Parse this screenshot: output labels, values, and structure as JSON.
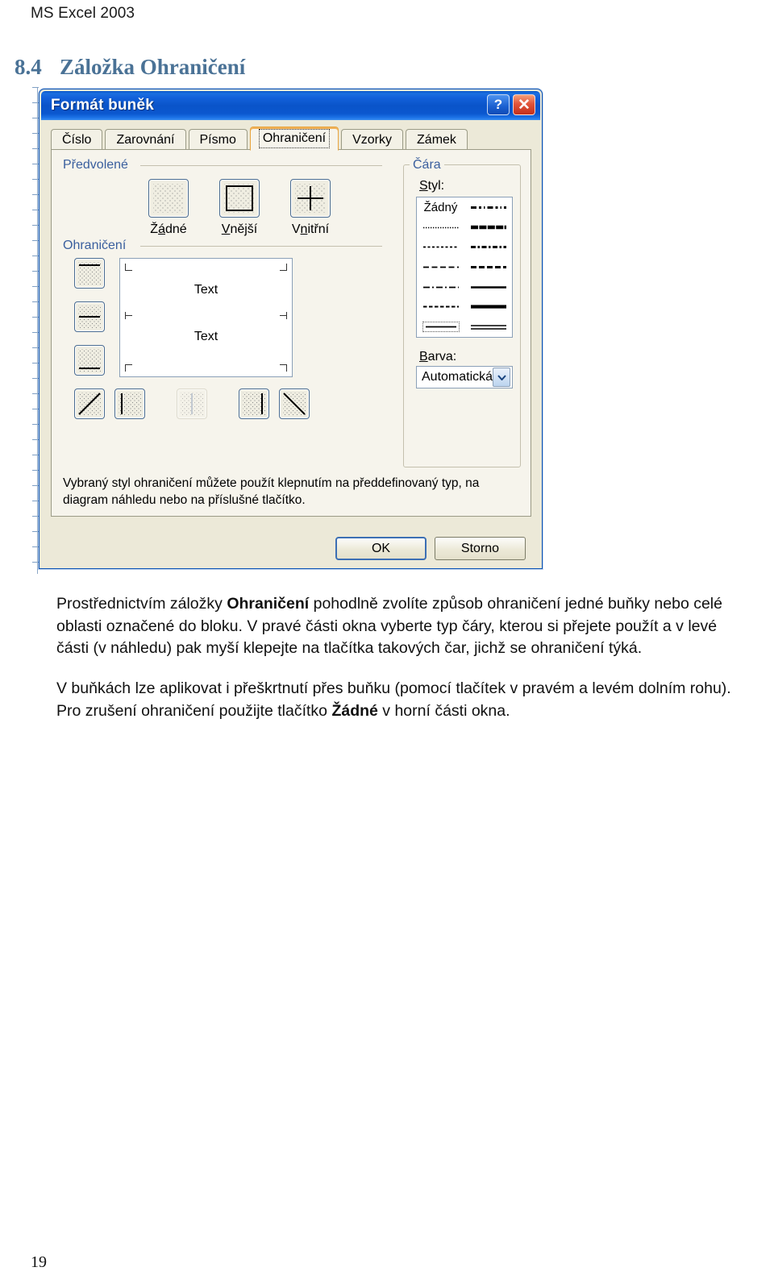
{
  "document": {
    "running_header": "MS Excel 2003",
    "section_number": "8.4",
    "section_title": "Záložka Ohraničení",
    "page_number": "19"
  },
  "dialog": {
    "title": "Formát buněk",
    "titlebar_buttons": {
      "help": "?",
      "close": "✕"
    },
    "tabs": [
      {
        "label": "Číslo",
        "active": false
      },
      {
        "label": "Zarovnání",
        "active": false
      },
      {
        "label": "Písmo",
        "active": false
      },
      {
        "label": "Ohraničení",
        "active": true
      },
      {
        "label": "Vzorky",
        "active": false
      },
      {
        "label": "Zámek",
        "active": false
      }
    ],
    "presets": {
      "group_label": "Předvolené",
      "buttons": [
        {
          "caption": "Žádné",
          "icon": "border-none-icon"
        },
        {
          "caption": "Vnější",
          "icon": "border-outline-icon"
        },
        {
          "caption": "Vnitřní",
          "icon": "border-inside-icon"
        }
      ]
    },
    "borders": {
      "group_label": "Ohraničení",
      "left_buttons": [
        {
          "icon": "border-top-icon"
        },
        {
          "icon": "border-horizontal-middle-icon"
        },
        {
          "icon": "border-bottom-icon"
        }
      ],
      "bottom_buttons": [
        {
          "icon": "border-diagonal-up-icon",
          "disabled": false
        },
        {
          "icon": "border-left-icon",
          "disabled": false
        },
        {
          "icon": "border-vertical-middle-icon",
          "disabled": true
        },
        {
          "icon": "border-right-icon",
          "disabled": false
        },
        {
          "icon": "border-diagonal-down-icon",
          "disabled": false
        }
      ],
      "preview": {
        "text_top": "Text",
        "text_bottom": "Text"
      }
    },
    "line": {
      "group_label": "Čára",
      "style_label": "Styl:",
      "style_none_label": "Žádný",
      "styles": [
        {
          "column": "left",
          "row": 1,
          "name": "none"
        },
        {
          "column": "left",
          "row": 2,
          "name": "fine-dotted"
        },
        {
          "column": "left",
          "row": 3,
          "name": "dotted"
        },
        {
          "column": "left",
          "row": 4,
          "name": "dashed-wide"
        },
        {
          "column": "left",
          "row": 5,
          "name": "dash-dot"
        },
        {
          "column": "left",
          "row": 6,
          "name": "dashed"
        },
        {
          "column": "left",
          "row": 7,
          "name": "thin-selected"
        },
        {
          "column": "right",
          "row": 1,
          "name": "dash-dot-dot"
        },
        {
          "column": "right",
          "row": 2,
          "name": "slanted-dash"
        },
        {
          "column": "right",
          "row": 3,
          "name": "medium-dash-dot"
        },
        {
          "column": "right",
          "row": 4,
          "name": "medium-dashed"
        },
        {
          "column": "right",
          "row": 5,
          "name": "thin-solid"
        },
        {
          "column": "right",
          "row": 6,
          "name": "thick-solid"
        },
        {
          "column": "right",
          "row": 7,
          "name": "double"
        }
      ],
      "color_label": "Barva:",
      "color_value": "Automatická",
      "color_dropdown_icon": "chevron-down-icon"
    },
    "hint": "Vybraný styl ohraničení můžete použít klepnutím na předdefinovaný typ, na diagram náhledu nebo na příslušné tlačítko.",
    "footer": {
      "ok_label": "OK",
      "cancel_label": "Storno"
    }
  },
  "body": {
    "paragraph1_part1": "Prostřednictvím záložky ",
    "paragraph1_bold": "Ohraničení",
    "paragraph1_part2": " pohodlně zvolíte způsob ohraničení jedné buňky nebo celé oblasti označené do bloku. V pravé části okna vyberte typ čáry, kterou si přejete použít a v levé části (v náhledu) pak myší klepejte na tlačítka takových čar, jichž se ohraničení týká.",
    "paragraph2_part1": "V buňkách lze aplikovat i přeškrtnutí přes buňku (pomocí tlačítek v pravém a levém dolním rohu). Pro zrušení ohraničení použijte tlačítko ",
    "paragraph2_bold": "Žádné",
    "paragraph2_part2": " v horní části okna."
  },
  "colors": {
    "heading": "#4a7296",
    "dialog_bg": "#ece9d8",
    "titlebar_blue": "#0b55c6",
    "group_label": "#3a5f9e",
    "tab_active_border": "#e8a33d"
  }
}
